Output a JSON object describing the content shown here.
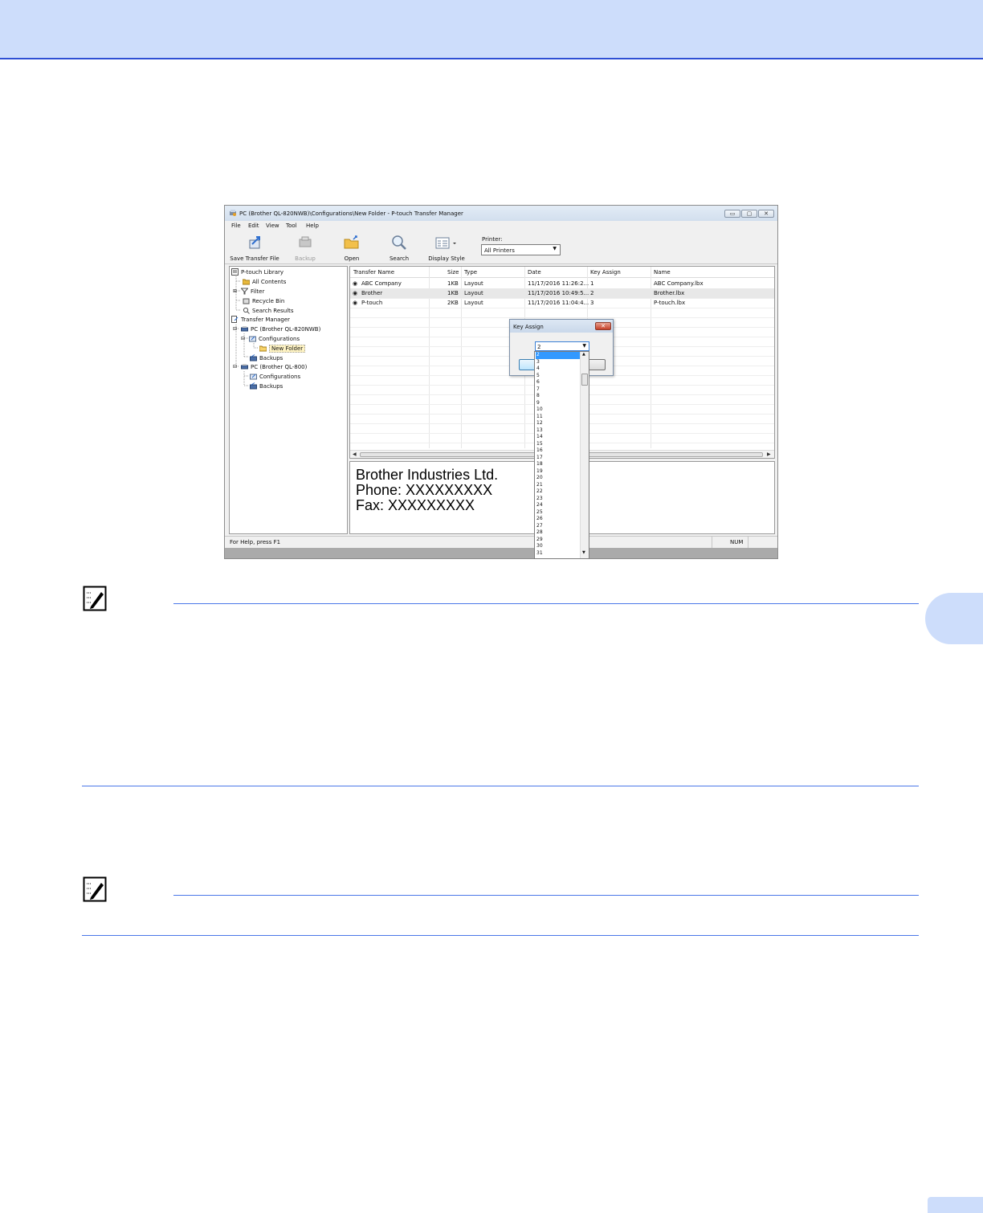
{
  "window": {
    "title": "PC (Brother QL-820NWB)\\Configurations\\New Folder - P-touch Transfer Manager",
    "controls": {
      "minimize": "▭",
      "maximize": "▢",
      "close": "✕"
    }
  },
  "menu": [
    "File",
    "Edit",
    "View",
    "Tool",
    "Help"
  ],
  "toolbar": {
    "buttons": [
      {
        "label": "Save Transfer File",
        "icon": "save-transfer-file-icon",
        "enabled": true
      },
      {
        "label": "Backup",
        "icon": "backup-icon",
        "enabled": false
      },
      {
        "label": "Open",
        "icon": "open-folder-icon",
        "enabled": true
      },
      {
        "label": "Search",
        "icon": "magnifier-icon",
        "enabled": true
      },
      {
        "label": "Display Style",
        "icon": "display-style-icon",
        "enabled": true
      }
    ],
    "printer_label": "Printer:",
    "printer_value": "All Printers"
  },
  "tree": [
    {
      "label": "P-touch Library",
      "icon": "library-icon"
    },
    {
      "label": "All Contents",
      "icon": "folder-icon"
    },
    {
      "label": "Filter",
      "icon": "filter-icon"
    },
    {
      "label": "Recycle Bin",
      "icon": "recycle-bin-icon"
    },
    {
      "label": "Search Results",
      "icon": "search-results-icon"
    },
    {
      "label": "Transfer Manager",
      "icon": "transfer-manager-icon"
    },
    {
      "label": "PC (Brother QL-820NWB)",
      "icon": "printer-icon"
    },
    {
      "label": "Configurations",
      "icon": "configurations-icon"
    },
    {
      "label": "New Folder",
      "icon": "folder-icon"
    },
    {
      "label": "Backups",
      "icon": "backups-icon"
    },
    {
      "label": "PC (Brother QL-800)",
      "icon": "printer-icon"
    },
    {
      "label": "Configurations",
      "icon": "configurations-icon"
    },
    {
      "label": "Backups",
      "icon": "backups-icon"
    }
  ],
  "list": {
    "columns": [
      "Transfer Name",
      "Size",
      "Type",
      "Date",
      "Key Assign",
      "Name"
    ],
    "rows": [
      {
        "transfer_name": "ABC Company",
        "size": "1KB",
        "type": "Layout",
        "date": "11/17/2016 11:26:2...",
        "key": "1",
        "name": "ABC Company.lbx"
      },
      {
        "transfer_name": "Brother",
        "size": "1KB",
        "type": "Layout",
        "date": "11/17/2016 10:49:5...",
        "key": "2",
        "name": "Brother.lbx"
      },
      {
        "transfer_name": "P-touch",
        "size": "2KB",
        "type": "Layout",
        "date": "11/17/2016 11:04:4...",
        "key": "3",
        "name": "P-touch.lbx"
      }
    ]
  },
  "preview": {
    "lines": [
      "Brother Industries Ltd.",
      "Phone: XXXXXXXXX",
      "Fax: XXXXXXXXX"
    ]
  },
  "dialog": {
    "title": "Key Assign",
    "close": "✕",
    "value": "2",
    "options": [
      "2",
      "3",
      "4",
      "5",
      "6",
      "7",
      "8",
      "9",
      "10",
      "11",
      "12",
      "13",
      "14",
      "15",
      "16",
      "17",
      "18",
      "19",
      "20",
      "21",
      "22",
      "23",
      "24",
      "25",
      "26",
      "27",
      "28",
      "29",
      "30",
      "31"
    ]
  },
  "status": {
    "help": "For Help, press F1",
    "num": "NUM"
  },
  "colors": {
    "accent_blue": "#2e4fd4",
    "banner": "#cdddfb",
    "selection": "#3399ff"
  }
}
